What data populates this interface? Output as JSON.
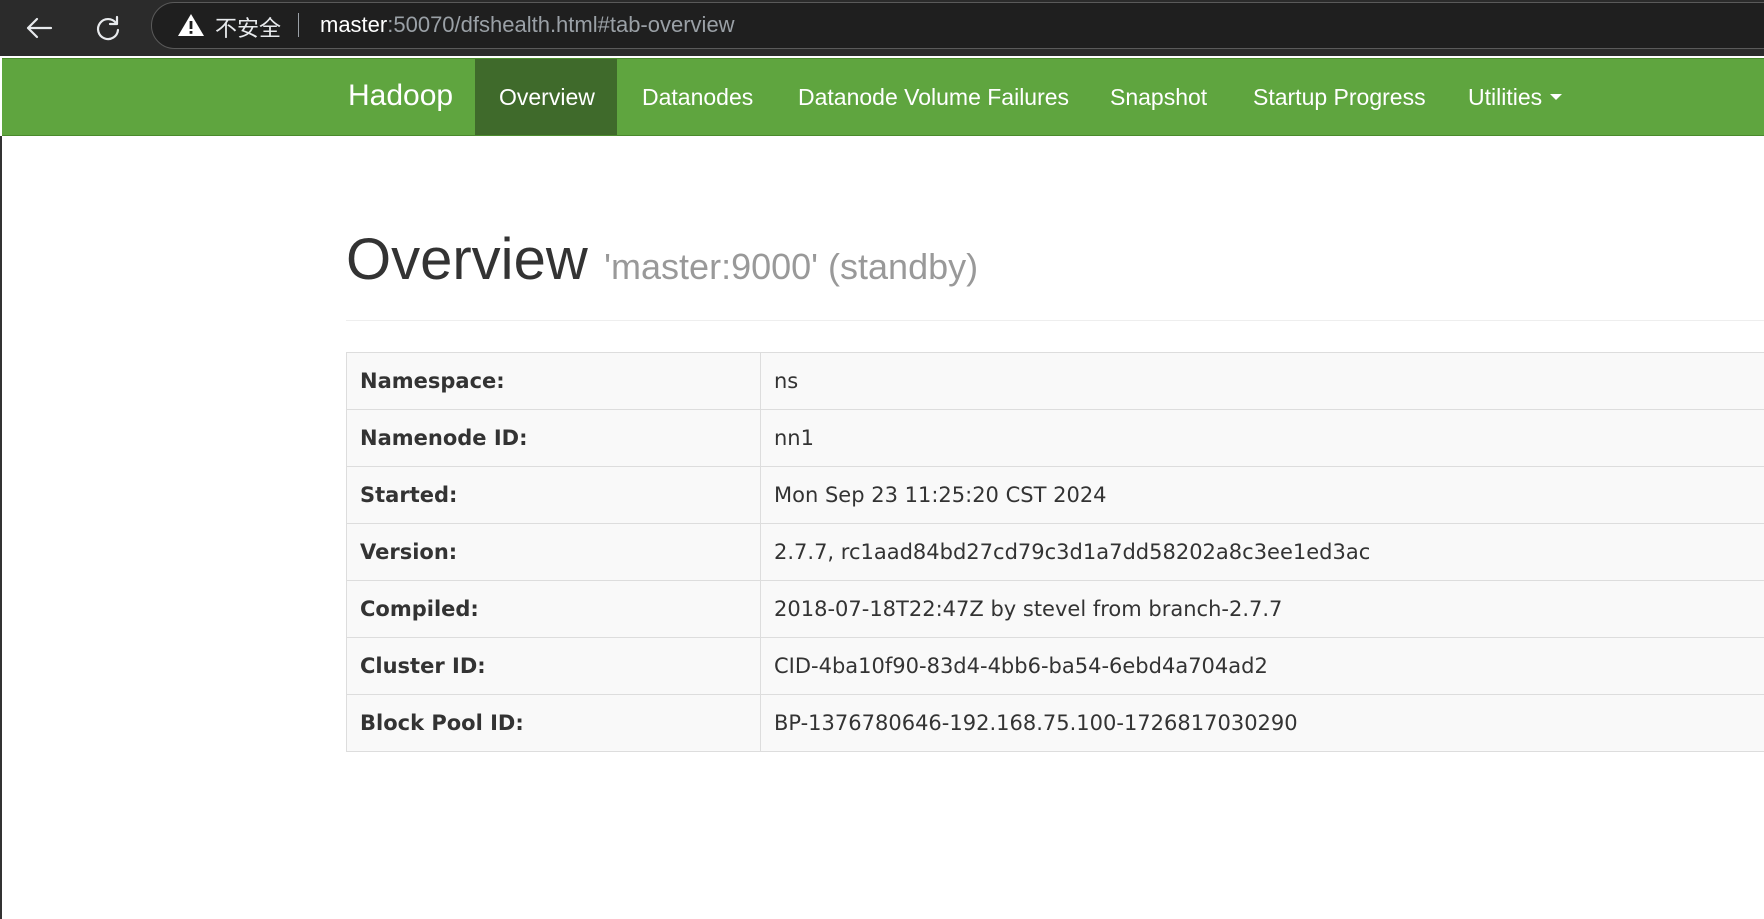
{
  "browser": {
    "insecure_label": "不安全",
    "url_host": "master",
    "url_rest": ":50070/dfshealth.html#tab-overview"
  },
  "navbar": {
    "brand": "Hadoop",
    "items": [
      {
        "label": "Overview",
        "active": true
      },
      {
        "label": "Datanodes"
      },
      {
        "label": "Datanode Volume Failures"
      },
      {
        "label": "Snapshot"
      },
      {
        "label": "Startup Progress"
      },
      {
        "label": "Utilities"
      }
    ]
  },
  "page": {
    "title": "Overview",
    "subtitle": "'master:9000' (standby)"
  },
  "info_table": {
    "rows": [
      {
        "key": "Namespace:",
        "value": "ns"
      },
      {
        "key": "Namenode ID:",
        "value": "nn1"
      },
      {
        "key": "Started:",
        "value": "Mon Sep 23 11:25:20 CST 2024"
      },
      {
        "key": "Version:",
        "value": "2.7.7, rc1aad84bd27cd79c3d1a7dd58202a8c3ee1ed3ac"
      },
      {
        "key": "Compiled:",
        "value": "2018-07-18T22:47Z by stevel from branch-2.7.7"
      },
      {
        "key": "Cluster ID:",
        "value": "CID-4ba10f90-83d4-4bb6-ba54-6ebd4a704ad2"
      },
      {
        "key": "Block Pool ID:",
        "value": "BP-1376780646-192.168.75.100-1726817030290"
      }
    ]
  },
  "colors": {
    "navbar_bg": "#5fa53f",
    "navbar_active_bg": "#3f6a2b",
    "browser_bg": "#2b2b2b"
  },
  "icons": {
    "back": "back-arrow-icon",
    "reload": "reload-icon",
    "warning": "warning-icon",
    "utilities_caret": "caret-down-icon"
  }
}
